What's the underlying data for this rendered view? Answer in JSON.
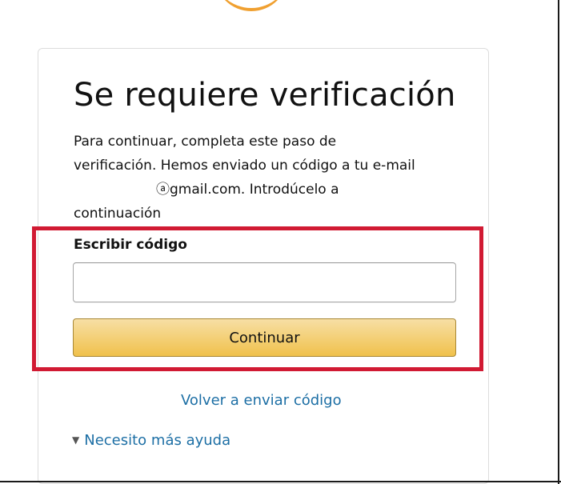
{
  "header": {
    "logo_icon": "amazon-smile-logo-icon",
    "accent_color": "#f0a030"
  },
  "card": {
    "title": "Se requiere verificación",
    "description": {
      "line1": "Para continuar, completa este paso de",
      "line2": "verificación. Hemos enviado un código a tu e-mail",
      "line3": "ⓐgmail.com. Introdúcelo a",
      "line4": "continuación"
    },
    "code_field": {
      "label": "Escribir código",
      "value": "",
      "placeholder": ""
    },
    "continue_button": {
      "label": "Continuar",
      "color": "#f0c14b"
    },
    "resend_link": "Volver a enviar código",
    "help_link": {
      "icon": "chevron-down-icon",
      "label": "Necesito más ayuda"
    },
    "link_color": "#1d6fa5"
  },
  "annotation": {
    "highlight_color": "#d11a33"
  }
}
